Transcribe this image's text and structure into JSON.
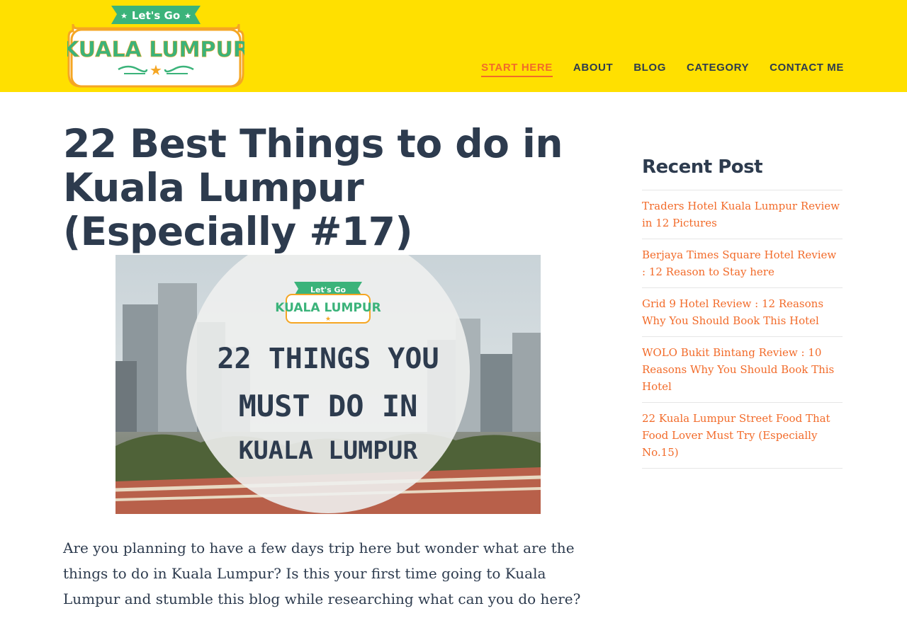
{
  "header": {
    "logo": {
      "top_text": "Let's Go",
      "main_text": "KUALA LUMPUR"
    },
    "nav": [
      {
        "label": "START HERE",
        "active": true
      },
      {
        "label": "ABOUT",
        "active": false
      },
      {
        "label": "BLOG",
        "active": false
      },
      {
        "label": "CATEGORY",
        "active": false
      },
      {
        "label": "CONTACT ME",
        "active": false
      }
    ]
  },
  "post": {
    "title": "22 Best Things to do in Kuala Lumpur (Especially #17)",
    "image": {
      "badge_top": "Let's Go",
      "badge_main": "KUALA LUMPUR",
      "line1": "22 THINGS YOU",
      "line2": "MUST DO IN",
      "line3": "KUALA LUMPUR"
    },
    "intro": "Are you planning to have a few days trip here but wonder what are the things to do in Kuala Lumpur? Is this your first time going to Kuala Lumpur and stumble this blog while researching what can you do here?"
  },
  "sidebar": {
    "heading": "Recent Post",
    "items": [
      "Traders Hotel Kuala Lumpur Review in 12 Pictures",
      "Berjaya Times Square Hotel Review : 12 Reason to Stay here",
      "Grid 9 Hotel Review : 12 Reasons Why You Should Book This Hotel",
      "WOLO Bukit Bintang Review : 10 Reasons Why You Should Book This Hotel",
      "22 Kuala Lumpur Street Food That Food Lover Must Try (Especially No.15)"
    ]
  },
  "colors": {
    "header_bg": "#ffe000",
    "text_dark": "#2d3b4e",
    "accent_orange": "#f26b2a",
    "logo_green": "#3bb37a"
  }
}
